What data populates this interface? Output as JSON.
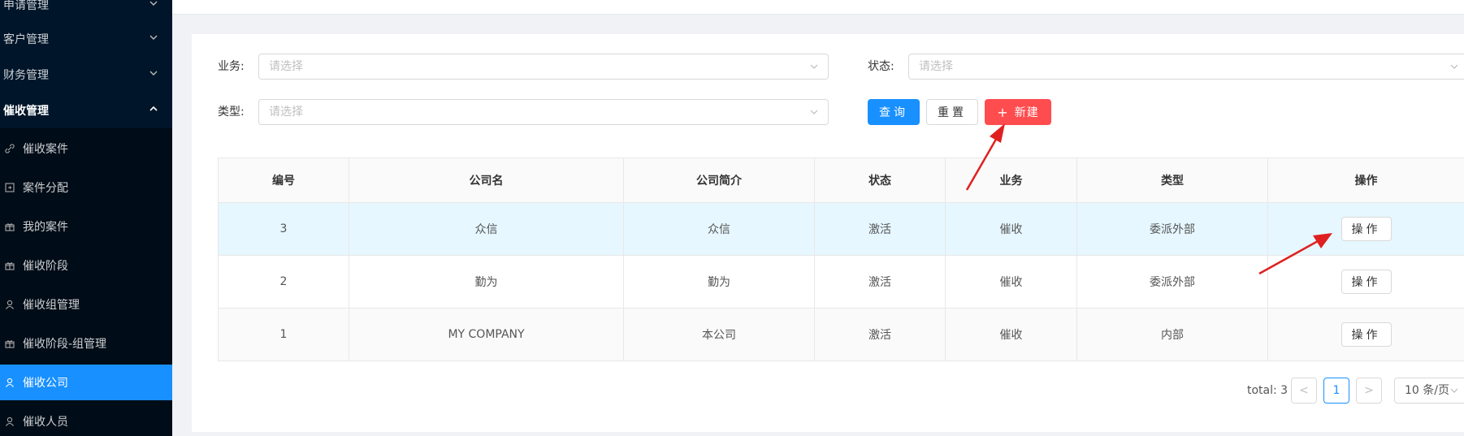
{
  "sidebar": {
    "top_menus": [
      {
        "label": "申请管理"
      },
      {
        "label": "客户管理"
      },
      {
        "label": "财务管理"
      },
      {
        "label": "催收管理"
      }
    ],
    "sub_items": [
      {
        "label": "催收案件",
        "icon": "link-icon"
      },
      {
        "label": "案件分配",
        "icon": "assign-icon"
      },
      {
        "label": "我的案件",
        "icon": "gift-icon"
      },
      {
        "label": "催收阶段",
        "icon": "gift-icon"
      },
      {
        "label": "催收组管理",
        "icon": "user-icon"
      },
      {
        "label": "催收阶段-组管理",
        "icon": "gift-icon"
      },
      {
        "label": "催收公司",
        "icon": "user-icon",
        "active": true
      },
      {
        "label": "催收人员",
        "icon": "user-icon"
      }
    ]
  },
  "filters": {
    "business_label": "业务:",
    "business_placeholder": "请选择",
    "status_label": "状态:",
    "status_placeholder": "请选择",
    "type_label": "类型:",
    "type_placeholder": "请选择"
  },
  "actions": {
    "query_label": "查询",
    "reset_label": "重置",
    "new_label": "新建"
  },
  "table": {
    "columns": [
      "编号",
      "公司名",
      "公司简介",
      "状态",
      "业务",
      "类型",
      "操作"
    ],
    "rows": [
      {
        "id": "3",
        "name": "众信",
        "intro": "众信",
        "status": "激活",
        "business": "催收",
        "type": "委派外部",
        "op": "操作"
      },
      {
        "id": "2",
        "name": "勤为",
        "intro": "勤为",
        "status": "激活",
        "business": "催收",
        "type": "委派外部",
        "op": "操作"
      },
      {
        "id": "1",
        "name": "MY COMPANY",
        "intro": "本公司",
        "status": "激活",
        "business": "催收",
        "type": "内部",
        "op": "操作"
      }
    ]
  },
  "pagination": {
    "total": "total: 3",
    "current_page": "1",
    "prev": "<",
    "next": ">",
    "page_size": "10 条/页"
  },
  "colors": {
    "sidebar_bg": "#001529",
    "active": "#1890ff",
    "danger": "#ff4d4f",
    "annotation": "#e02020"
  }
}
